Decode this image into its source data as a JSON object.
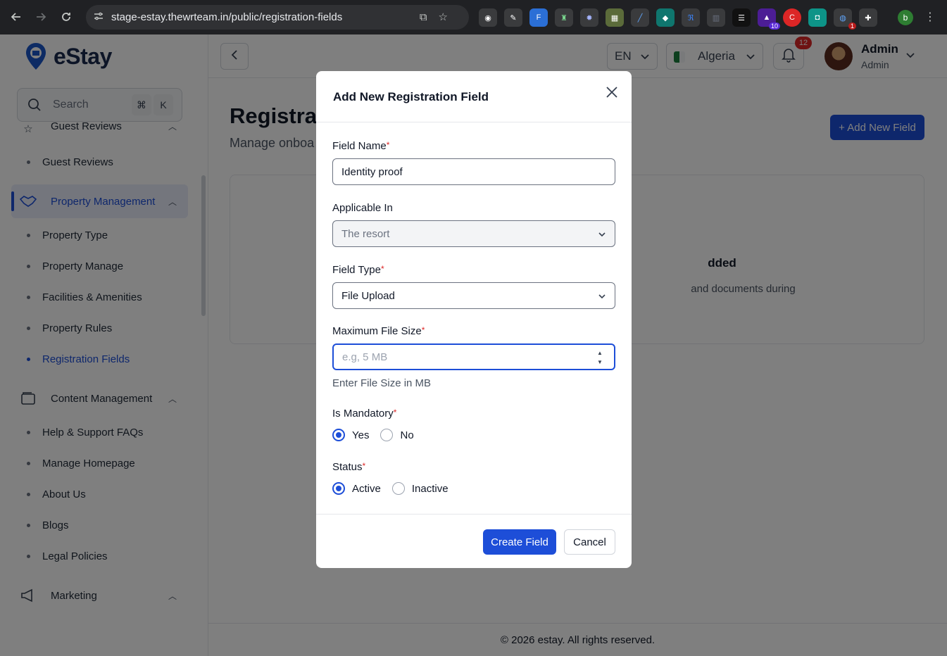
{
  "browser": {
    "url": "stage-estay.thewrteam.in/public/registration-fields",
    "ext_badges": [
      "10",
      "1"
    ],
    "profile_initial": "b"
  },
  "app": {
    "logo_text": "eStay",
    "search": {
      "placeholder": "Search",
      "kbd1": "⌘",
      "kbd2": "K"
    },
    "sidebar": {
      "group_guest": "Guest Reviews",
      "sub_guest_reviews": "Guest Reviews",
      "group_property": "Property Management",
      "property_items": [
        "Property Type",
        "Property Manage",
        "Facilities & Amenities",
        "Property Rules",
        "Registration Fields"
      ],
      "group_content": "Content Management",
      "content_items": [
        "Help & Support FAQs",
        "Manage Homepage",
        "About Us",
        "Blogs",
        "Legal Policies"
      ],
      "group_marketing": "Marketing"
    },
    "topbar": {
      "language": "EN",
      "country": "Algeria",
      "notifications": "12",
      "user_name": "Admin",
      "user_role": "Admin"
    },
    "page": {
      "title": "Registrat",
      "subtitle": "Manage onboa",
      "add_button": "+ Add New Field",
      "empty_title": "dded",
      "empty_desc": "and documents during"
    },
    "footer": "© 2026 estay. All rights reserved."
  },
  "modal": {
    "title": "Add New Registration Field",
    "field_name": {
      "label": "Field Name",
      "value": "Identity proof"
    },
    "applicable_in": {
      "label": "Applicable In",
      "value": "The resort"
    },
    "field_type": {
      "label": "Field Type",
      "value": "File Upload"
    },
    "max_file_size": {
      "label": "Maximum File Size",
      "placeholder": "e.g, 5 MB",
      "hint": "Enter File Size in MB"
    },
    "is_mandatory": {
      "label": "Is Mandatory",
      "options": [
        "Yes",
        "No"
      ],
      "selected": "Yes"
    },
    "status": {
      "label": "Status",
      "options": [
        "Active",
        "Inactive"
      ],
      "selected": "Active"
    },
    "create_button": "Create Field",
    "cancel_button": "Cancel"
  },
  "colors": {
    "primary": "#1d4ed8",
    "required": "#dc2626",
    "overlay": "rgba(0,0,0,0.5)"
  }
}
